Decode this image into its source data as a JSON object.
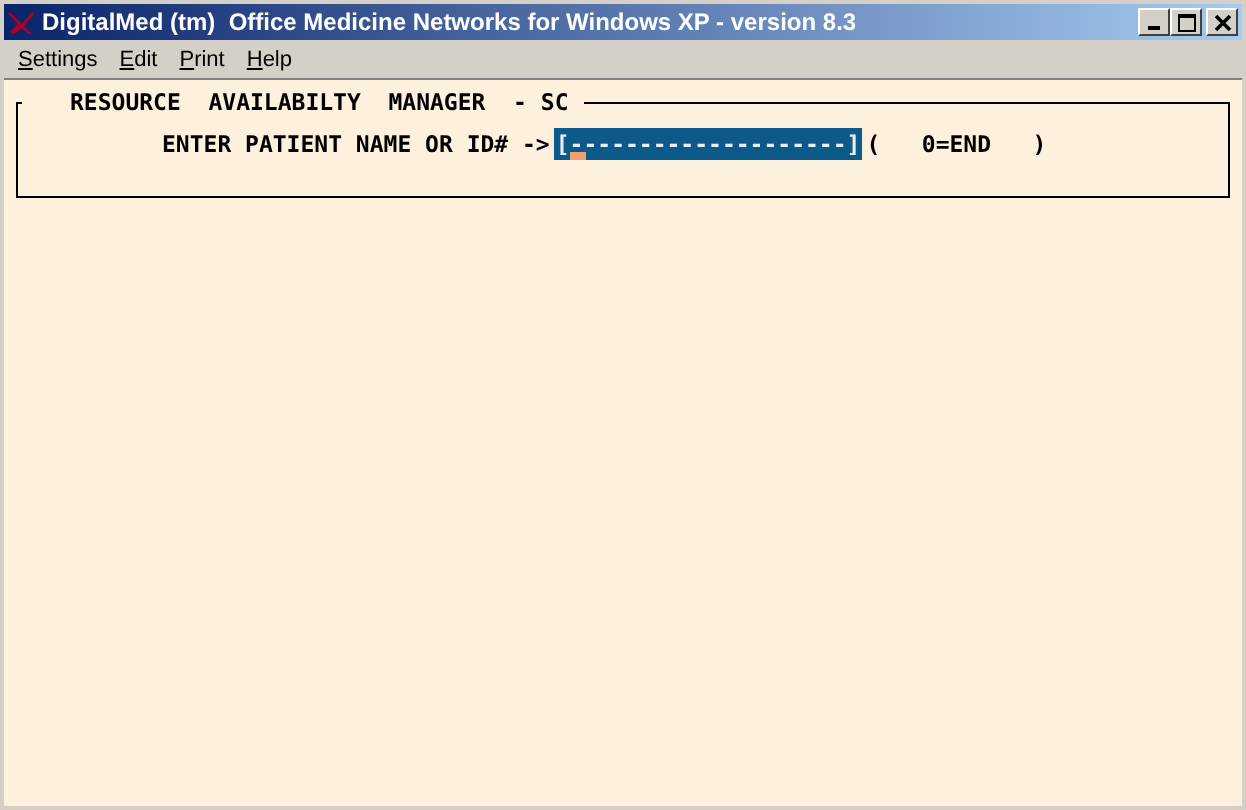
{
  "window": {
    "title": "DigitalMed (tm)  Office Medicine Networks for Windows XP - version 8.3"
  },
  "menu": [
    "Settings",
    "Edit",
    "Print",
    "Help"
  ],
  "panel": {
    "title": "RESOURCE  AVAILABILTY  MANAGER  - SC",
    "prompt": "ENTER PATIENT NAME OR ID# ->",
    "field_value": "[--------------------]",
    "hint": "(   0=END   )"
  }
}
